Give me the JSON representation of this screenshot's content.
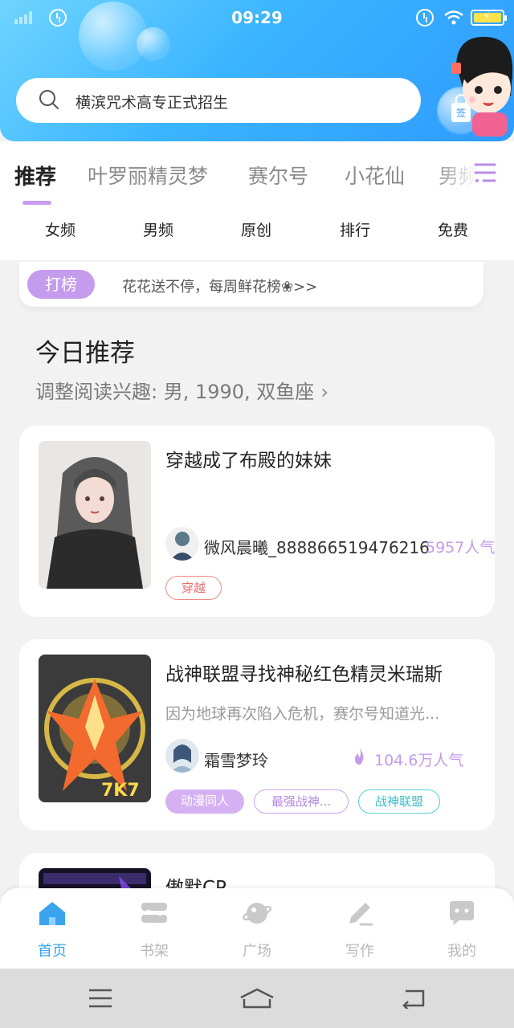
{
  "status_bar": {
    "time": "09:29"
  },
  "search": {
    "placeholder": "横滨咒术高专正式招生"
  },
  "signin": {
    "label": "签"
  },
  "tabs": [
    {
      "label": "推荐",
      "active": true
    },
    {
      "label": "叶罗丽精灵梦"
    },
    {
      "label": "赛尔号"
    },
    {
      "label": "小花仙"
    },
    {
      "label": "男频"
    }
  ],
  "subnav": [
    "女频",
    "男频",
    "原创",
    "排行",
    "免费"
  ],
  "rank": {
    "badge": "打榜",
    "text": "花花送不停，每周鲜花榜❀>>"
  },
  "section": {
    "title": "今日推荐",
    "subtitle": "调整阅读兴趣: 男, 1990, 双鱼座"
  },
  "cards": [
    {
      "title": "穿越成了布殿的妹妹",
      "desc": "",
      "author": "微风晨曦_888866519476216",
      "popularity": "5957人气",
      "tags": [
        "穿越"
      ]
    },
    {
      "title": "战神联盟寻找神秘红色精灵米瑞斯",
      "desc": "因为地球再次陷入危机，赛尔号知道光...",
      "author": "霜雪梦玲",
      "popularity": "104.6万人气",
      "tags": [
        "动漫同人",
        "最强战神...",
        "战神联盟"
      ],
      "cover_text": "7K7"
    },
    {
      "title": "傲默CP"
    }
  ],
  "bottom_nav": [
    {
      "label": "首页",
      "icon": "home-icon",
      "active": true
    },
    {
      "label": "书架",
      "icon": "bookshelf-icon"
    },
    {
      "label": "广场",
      "icon": "planet-icon"
    },
    {
      "label": "写作",
      "icon": "pen-icon"
    },
    {
      "label": "我的",
      "icon": "chat-bubble-icon"
    }
  ],
  "colors": {
    "accent_purple": "#c59bed",
    "header_blue": "#3bb4ff",
    "active_blue": "#3aa5ee"
  }
}
